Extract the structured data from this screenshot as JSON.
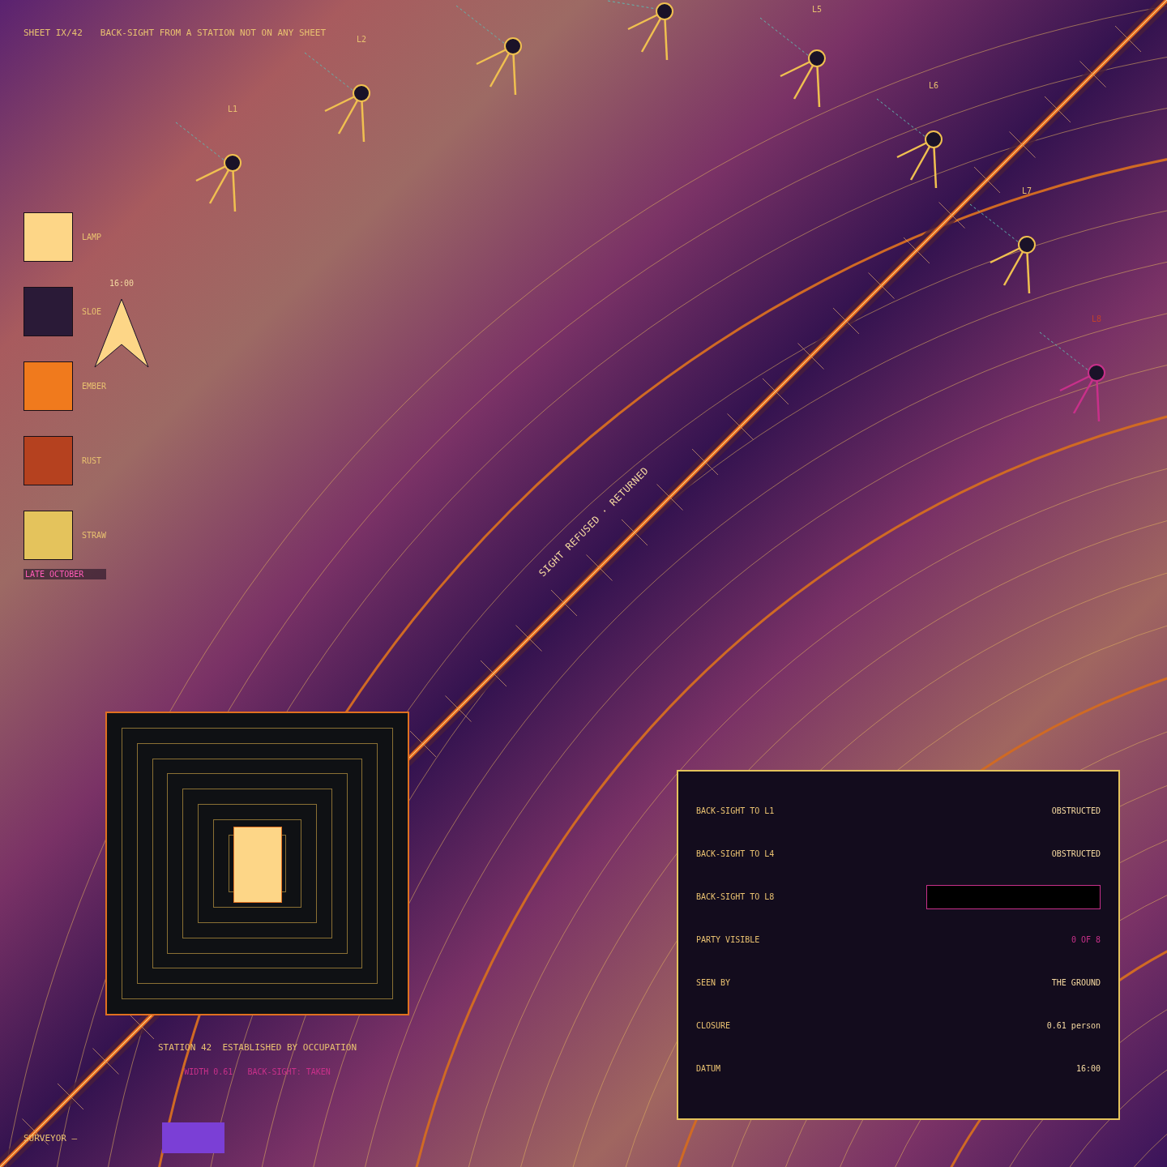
{
  "header": {
    "sheet": "SHEET IX/42",
    "title": "BACK-SIGHT FROM A STATION NOT ON ANY SHEET"
  },
  "stations": [
    {
      "label": "L1",
      "kind": "lamp"
    },
    {
      "label": "L2",
      "kind": "lamp"
    },
    {
      "kind": "lamp"
    },
    {
      "kind": "lamp"
    },
    {
      "label": "L5",
      "kind": "lamp"
    },
    {
      "label": "L6",
      "kind": "lamp"
    },
    {
      "label": "L7",
      "kind": "lamp"
    },
    {
      "label": "L8",
      "kind": "refused"
    }
  ],
  "legend": [
    {
      "name": "LAMP",
      "color": "#fdd687"
    },
    {
      "name": "SLOE",
      "color": "#2a1a37"
    },
    {
      "name": "EMBER",
      "color": "#f07a1d"
    },
    {
      "name": "RUST",
      "color": "#b5411f"
    },
    {
      "name": "STRAW",
      "color": "#e4c35c"
    }
  ],
  "legend_note": "LATE OCTOBER",
  "north_arrow": {
    "time": "16:00"
  },
  "route_label": "SIGHT REFUSED · RETURNED",
  "station_panel": {
    "title": "STATION 42  ESTABLISHED BY OCCUPATION",
    "subtitle": "WIDTH 0.61   BACK-SIGHT: TAKEN"
  },
  "signature": {
    "label": "SURVEYOR —"
  },
  "readings": [
    {
      "label": "BACK-SIGHT TO L1",
      "value": "OBSTRUCTED",
      "kind": "text"
    },
    {
      "label": "BACK-SIGHT TO L4",
      "value": "OBSTRUCTED",
      "kind": "text"
    },
    {
      "label": "BACK-SIGHT TO L8",
      "kind": "redacted"
    },
    {
      "label": "PARTY VISIBLE",
      "value": "0 OF 8",
      "kind": "alert"
    },
    {
      "label": "SEEN BY",
      "value": "THE GROUND",
      "kind": "text"
    },
    {
      "label": "CLOSURE",
      "value": "0.61 person",
      "kind": "text"
    },
    {
      "label": "DATUM",
      "value": "16:00",
      "kind": "text"
    }
  ]
}
